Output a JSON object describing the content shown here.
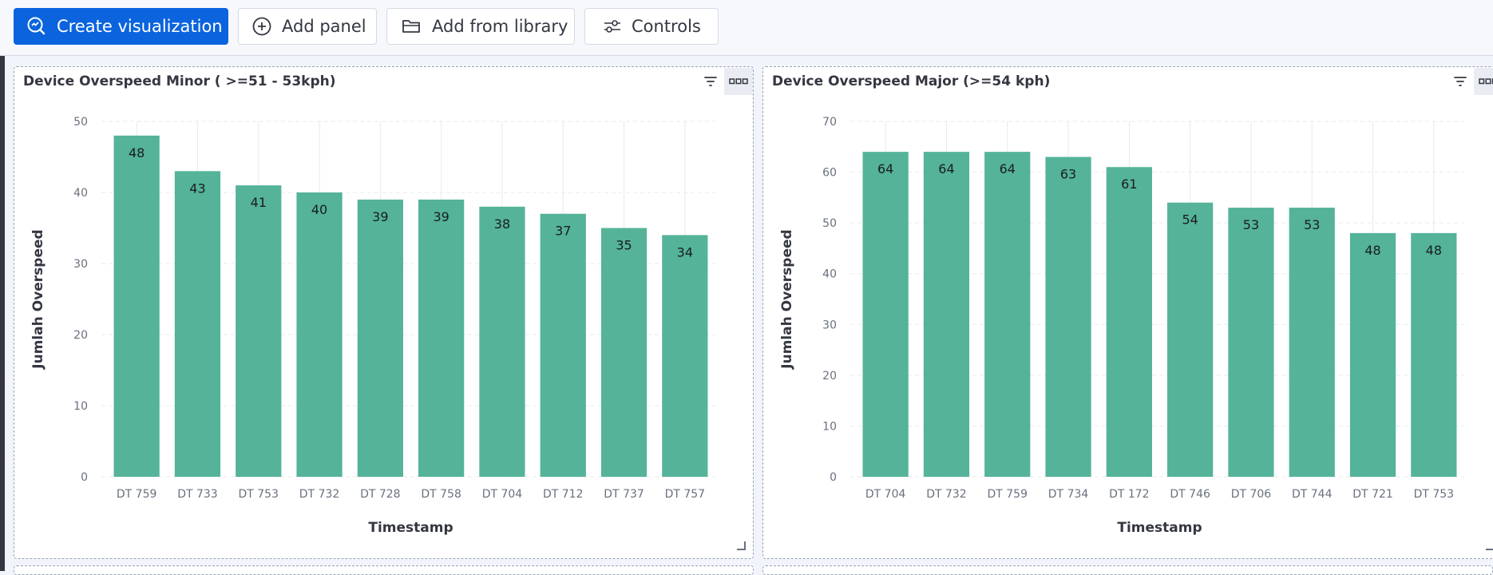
{
  "toolbar": {
    "create_visualization": "Create visualization",
    "add_panel": "Add panel",
    "add_from_library": "Add from library",
    "controls": "Controls"
  },
  "icons": {
    "create_visualization": "visualize-icon",
    "add_panel": "plus-circle-icon",
    "add_from_library": "folder-open-icon",
    "controls": "controls-sliders-icon",
    "panel_filter": "filter-icon",
    "panel_menu": "options-menu-icon"
  },
  "colors": {
    "primary": "#0b64dd",
    "bar": "#54b399",
    "axis_text": "#69707d",
    "grid": "#e6e9ef"
  },
  "panels": [
    {
      "title": "Device Overspeed Minor ( >=51 - 53kph)"
    },
    {
      "title": "Device Overspeed Major (>=54 kph)"
    }
  ],
  "chart_data": [
    {
      "type": "bar",
      "title": "Device Overspeed Minor ( >=51 - 53kph)",
      "xlabel": "Timestamp",
      "ylabel": "Jumlah Overspeed",
      "categories": [
        "DT 759",
        "DT 733",
        "DT 753",
        "DT 732",
        "DT 728",
        "DT 758",
        "DT 704",
        "DT 712",
        "DT 737",
        "DT 757"
      ],
      "values": [
        48,
        43,
        41,
        40,
        39,
        39,
        38,
        37,
        35,
        34
      ],
      "ylim": [
        0,
        50
      ],
      "yticks": [
        0,
        10,
        20,
        30,
        40,
        50
      ],
      "data_labels": true,
      "grid": true
    },
    {
      "type": "bar",
      "title": "Device Overspeed Major (>=54 kph)",
      "xlabel": "Timestamp",
      "ylabel": "Jumlah Overspeed",
      "categories": [
        "DT 704",
        "DT 732",
        "DT 759",
        "DT 734",
        "DT 172",
        "DT 746",
        "DT 706",
        "DT 744",
        "DT 721",
        "DT 753"
      ],
      "values": [
        64,
        64,
        64,
        63,
        61,
        54,
        53,
        53,
        48,
        48
      ],
      "ylim": [
        0,
        70
      ],
      "yticks": [
        0,
        10,
        20,
        30,
        40,
        50,
        60,
        70
      ],
      "data_labels": true,
      "grid": true
    }
  ]
}
